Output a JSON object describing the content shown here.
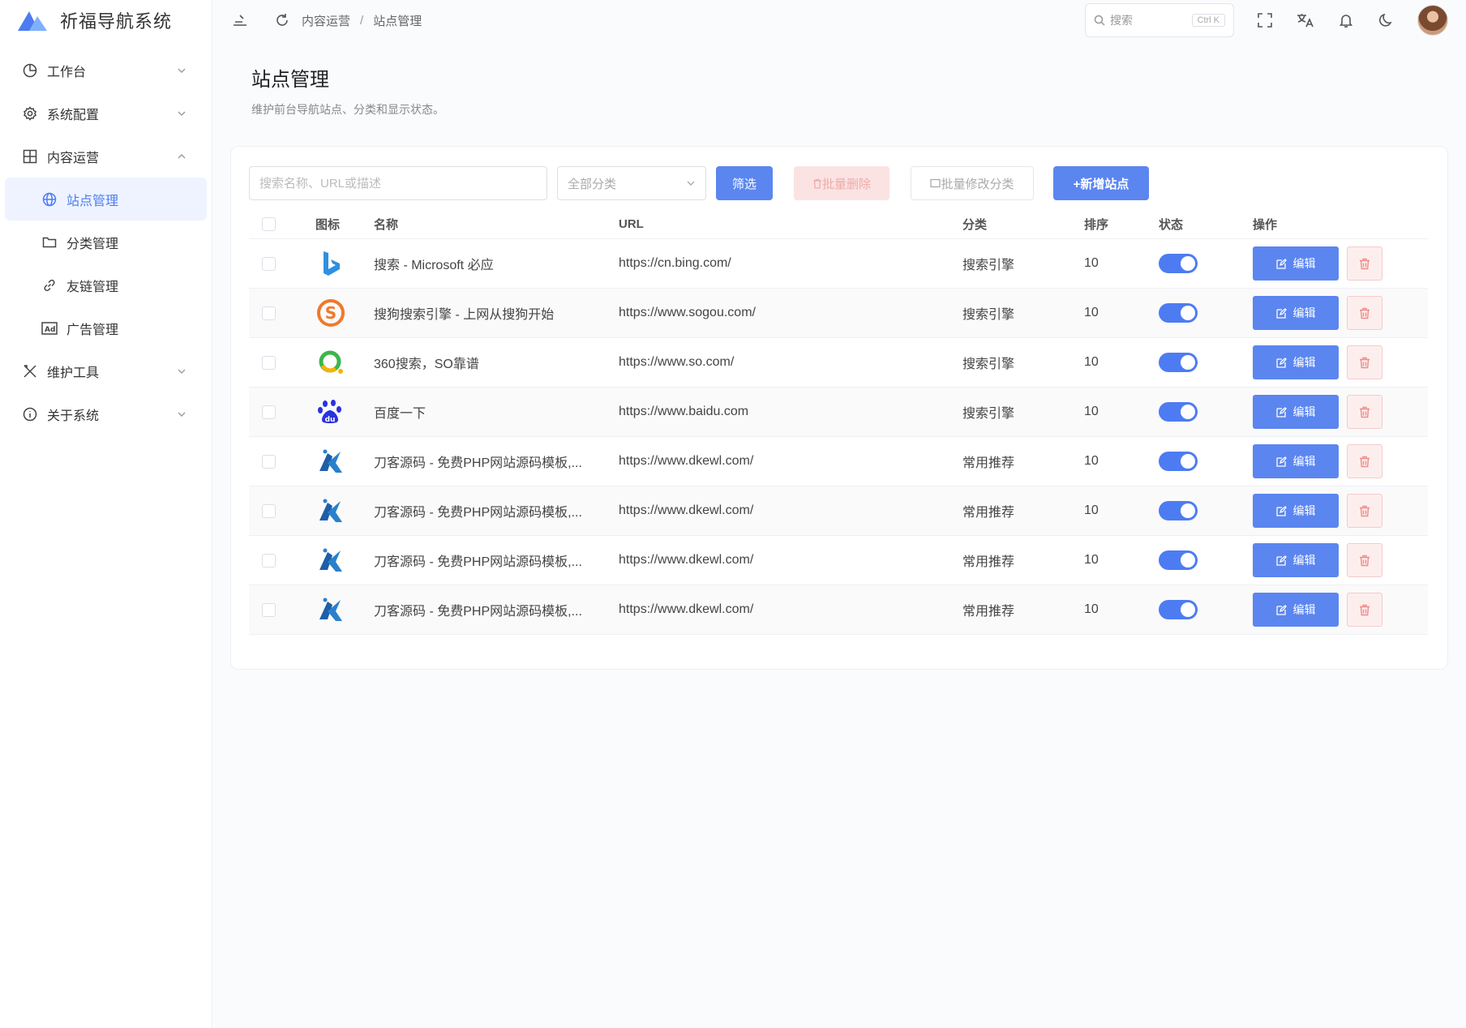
{
  "app": {
    "title": "祈福导航系统"
  },
  "sidebar": {
    "items": [
      {
        "label": "工作台",
        "icon": "pie-chart-icon"
      },
      {
        "label": "系统配置",
        "icon": "gear-icon"
      },
      {
        "label": "内容运营",
        "icon": "grid-icon"
      },
      {
        "label": "站点管理",
        "icon": "globe-icon",
        "active": true
      },
      {
        "label": "分类管理",
        "icon": "folder-icon"
      },
      {
        "label": "友链管理",
        "icon": "link-icon"
      },
      {
        "label": "广告管理",
        "icon": "ad-icon"
      },
      {
        "label": "维护工具",
        "icon": "tools-icon"
      },
      {
        "label": "关于系统",
        "icon": "info-icon"
      }
    ]
  },
  "topbar": {
    "breadcrumb": [
      "内容运营",
      "站点管理"
    ],
    "breadcrumb_sep": "/",
    "search_placeholder": "搜索",
    "search_shortcut": "Ctrl K"
  },
  "page": {
    "title": "站点管理",
    "subtitle": "维护前台导航站点、分类和显示状态。"
  },
  "toolbar": {
    "search_placeholder": "搜索名称、URL或描述",
    "category_select": "全部分类",
    "filter_label": "筛选",
    "batch_delete_label": "批量删除",
    "batch_category_label": "批量修改分类",
    "add_label": "+新增站点"
  },
  "table": {
    "columns": [
      "图标",
      "名称",
      "URL",
      "分类",
      "排序",
      "状态",
      "操作"
    ],
    "edit_label": "编辑",
    "rows": [
      {
        "icon": "bing-logo-icon",
        "name": "搜索 - Microsoft 必应",
        "url": "https://cn.bing.com/",
        "category": "搜索引擎",
        "sort": "10",
        "enabled": true
      },
      {
        "icon": "sogou-logo-icon",
        "name": "搜狗搜索引擎 - 上网从搜狗开始",
        "url": "https://www.sogou.com/",
        "category": "搜索引擎",
        "sort": "10",
        "enabled": true
      },
      {
        "icon": "so360-logo-icon",
        "name": "360搜索，SO靠谱",
        "url": "https://www.so.com/",
        "category": "搜索引擎",
        "sort": "10",
        "enabled": true
      },
      {
        "icon": "baidu-logo-icon",
        "name": "百度一下",
        "url": "https://www.baidu.com",
        "category": "搜索引擎",
        "sort": "10",
        "enabled": true
      },
      {
        "icon": "dkewl-logo-icon",
        "name": "刀客源码 - 免费PHP网站源码模板,...",
        "url": "https://www.dkewl.com/",
        "category": "常用推荐",
        "sort": "10",
        "enabled": true
      },
      {
        "icon": "dkewl-logo-icon",
        "name": "刀客源码 - 免费PHP网站源码模板,...",
        "url": "https://www.dkewl.com/",
        "category": "常用推荐",
        "sort": "10",
        "enabled": true
      },
      {
        "icon": "dkewl-logo-icon",
        "name": "刀客源码 - 免费PHP网站源码模板,...",
        "url": "https://www.dkewl.com/",
        "category": "常用推荐",
        "sort": "10",
        "enabled": true
      },
      {
        "icon": "dkewl-logo-icon",
        "name": "刀客源码 - 免费PHP网站源码模板,...",
        "url": "https://www.dkewl.com/",
        "category": "常用推荐",
        "sort": "10",
        "enabled": true
      }
    ]
  },
  "colors": {
    "primary": "#5b86f0",
    "danger": "#f0aaaa",
    "active_bg": "#eef3ff"
  }
}
